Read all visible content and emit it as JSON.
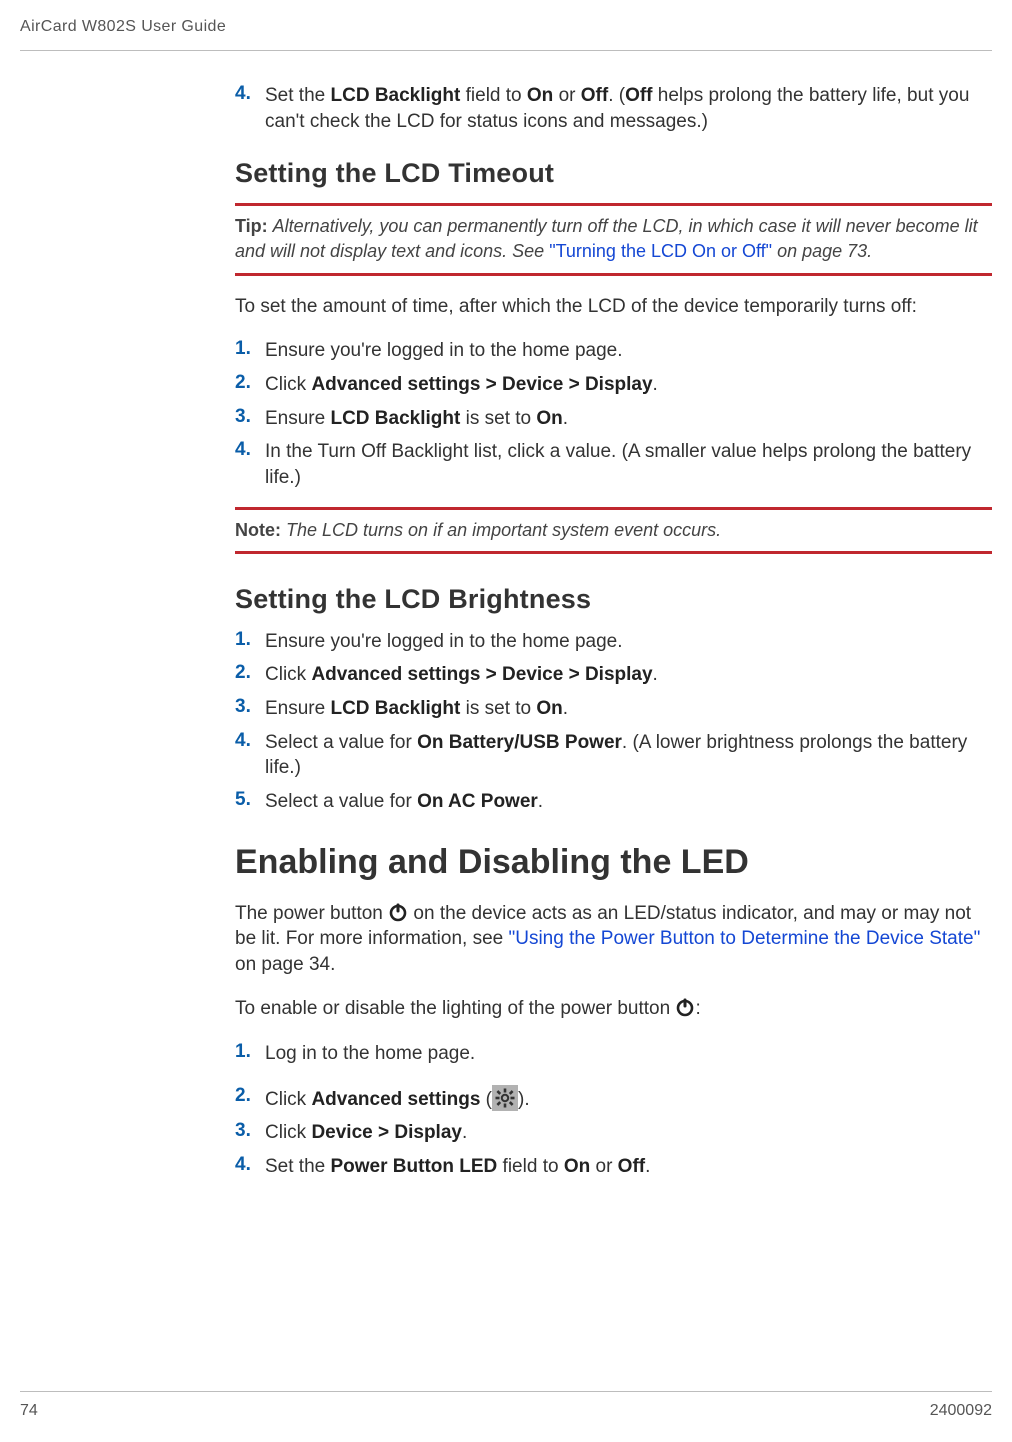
{
  "running_head": "AirCard W802S User Guide",
  "footer": {
    "page_num": "74",
    "doc_num": "2400092"
  },
  "pre_step4": {
    "num": "4.",
    "text_a": "Set the ",
    "bold_a": "LCD Backlight",
    "text_b": " field to ",
    "bold_b": "On",
    "text_c": " or ",
    "bold_c": "Off",
    "text_d": ". (",
    "bold_d": "Off",
    "text_e": " helps prolong the battery life, but you can't check the LCD for status icons and messages.)"
  },
  "sec_timeout": {
    "title": "Setting the LCD Timeout",
    "tip": {
      "lead": "Tip: ",
      "text_a": "Alternatively, you can permanently turn off the LCD, in which case it will never become lit and will not display text and icons. See ",
      "xref": "\"Turning the LCD On or Off\"",
      "text_b": " on page 73."
    },
    "intro": "To set the amount of time, after which the LCD of the device temporarily turns off:",
    "steps": {
      "s1": {
        "num": "1.",
        "text": "Ensure you're logged in to the home page."
      },
      "s2": {
        "num": "2.",
        "text_a": "Click ",
        "bold_a": "Advanced settings > Device > Display",
        "text_b": "."
      },
      "s3": {
        "num": "3.",
        "text_a": "Ensure ",
        "bold_a": "LCD Backlight",
        "text_b": " is set to ",
        "bold_b": "On",
        "text_c": "."
      },
      "s4": {
        "num": "4.",
        "text": "In the Turn Off Backlight list, click a value. (A smaller value helps prolong the battery life.)"
      }
    },
    "note": {
      "lead": "Note: ",
      "text": "The LCD turns on if an important system event occurs."
    }
  },
  "sec_brightness": {
    "title": "Setting the LCD Brightness",
    "steps": {
      "s1": {
        "num": "1.",
        "text": "Ensure you're logged in to the home page."
      },
      "s2": {
        "num": "2.",
        "text_a": "Click ",
        "bold_a": "Advanced settings > Device > Display",
        "text_b": "."
      },
      "s3": {
        "num": "3.",
        "text_a": "Ensure ",
        "bold_a": "LCD Backlight",
        "text_b": " is set to ",
        "bold_b": "On",
        "text_c": "."
      },
      "s4": {
        "num": "4.",
        "text_a": "Select a value for ",
        "bold_a": "On Battery/USB Power",
        "text_b": ". (A lower brightness prolongs the battery life.)"
      },
      "s5": {
        "num": "5.",
        "text_a": "Select a value for ",
        "bold_a": "On AC Power",
        "text_b": "."
      }
    }
  },
  "sec_led": {
    "title": "Enabling and Disabling the LED",
    "para1": {
      "text_a": "The power button ",
      "text_b": " on the device acts as an LED/status indicator, and may or may not be lit. For more information, see ",
      "xref": "\"Using the Power Button to Determine the Device State\"",
      "text_c": " on page 34."
    },
    "para2": {
      "text_a": "To enable or disable the lighting of the power button ",
      "text_b": ":"
    },
    "steps": {
      "s1": {
        "num": "1.",
        "text": "Log in to the home page."
      },
      "s2": {
        "num": "2.",
        "text_a": "Click ",
        "bold_a": "Advanced settings",
        "text_b": " (",
        "text_c": ")."
      },
      "s3": {
        "num": "3.",
        "text_a": "Click ",
        "bold_a": "Device > Display",
        "text_b": "."
      },
      "s4": {
        "num": "4.",
        "text_a": "Set the ",
        "bold_a": "Power Button LED",
        "text_b": " field to ",
        "bold_b": "On",
        "text_c": " or ",
        "bold_c": "Off",
        "text_d": "."
      }
    }
  }
}
